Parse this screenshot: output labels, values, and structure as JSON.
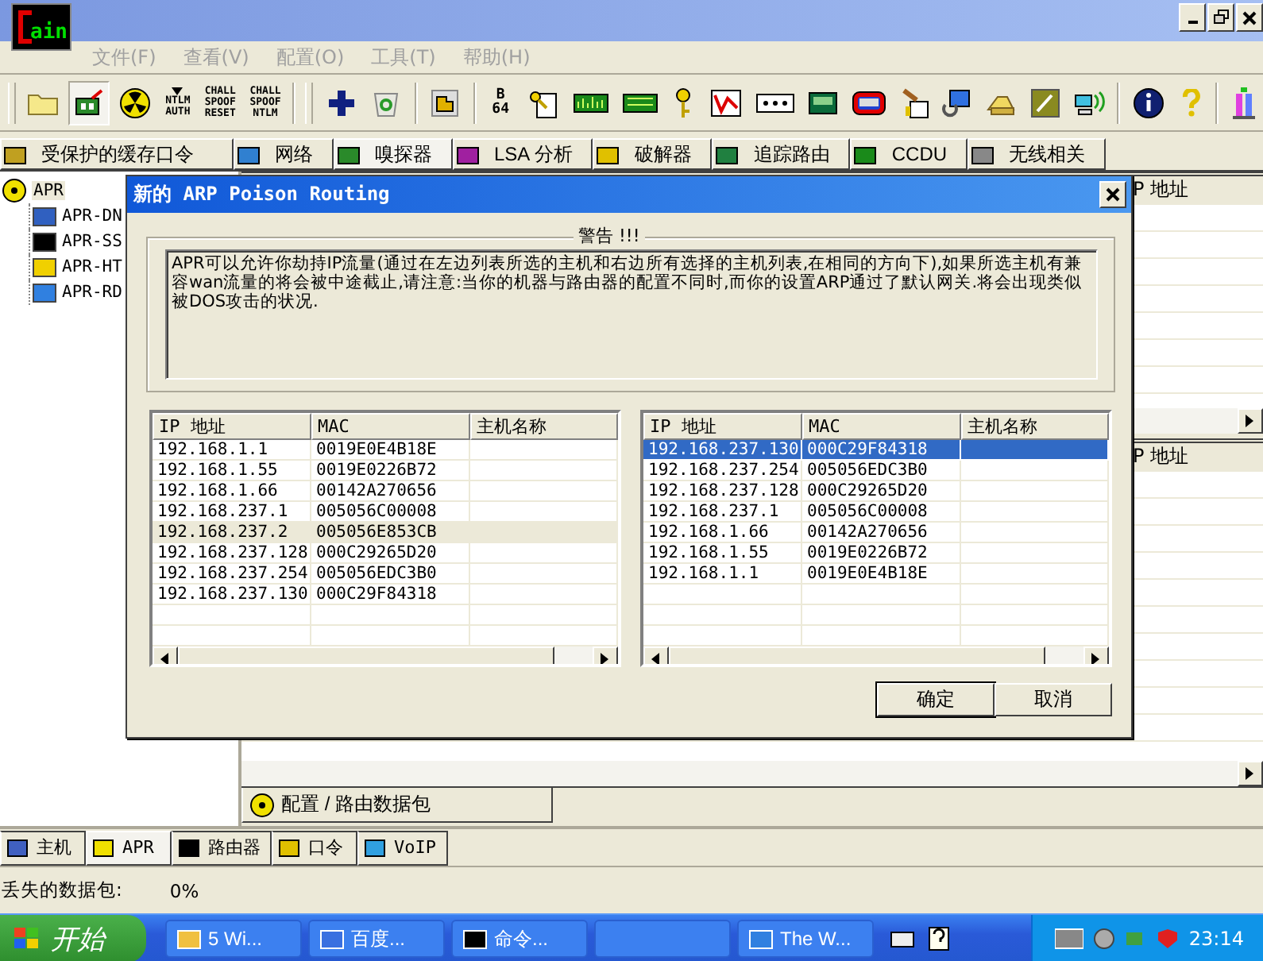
{
  "window": {
    "logo_text": "ain"
  },
  "menu": [
    {
      "label": "文件(F)",
      "disabled": true
    },
    {
      "label": "查看(V)",
      "disabled": true
    },
    {
      "label": "配置(O)",
      "disabled": true
    },
    {
      "label": "工具(T)",
      "disabled": true
    },
    {
      "label": "帮助(H)",
      "disabled": true
    }
  ],
  "toolbar_text": [
    "NTLM\nAUTH",
    "CHALL\nSPOOF\nRESET",
    "CHALL\nSPOOF\nNTLM",
    "B\n64"
  ],
  "tabs": [
    {
      "label": "受保护的缓存口令",
      "selected": false
    },
    {
      "label": "网络",
      "selected": false
    },
    {
      "label": "嗅探器",
      "selected": true
    },
    {
      "label": "LSA 分析",
      "selected": false
    },
    {
      "label": "破解器",
      "selected": false
    },
    {
      "label": "追踪路由",
      "selected": false
    },
    {
      "label": "CCDU",
      "selected": false
    },
    {
      "label": "无线相关",
      "selected": false
    }
  ],
  "tree": {
    "label": "APR",
    "children": [
      {
        "label": "APR-DN"
      },
      {
        "label": "APR-SS"
      },
      {
        "label": "APR-HT"
      },
      {
        "label": "APR-RD"
      }
    ]
  },
  "upper_list": {
    "column": "P 地址"
  },
  "lower_list": {
    "column": "P 地址",
    "tab": "配置 / 路由数据包"
  },
  "dialog": {
    "title": "新的 ARP Poison Routing",
    "group_title": "警告 !!!",
    "warning": "APR可以允许你劫持IP流量(通过在左边列表所选的主机和右边所有选择的主机列表,在相同的方向下),如果所选主机有兼容wan流量的将会被中途截止,请注意:当你的机器与路由器的配置不同时,而你的设置ARP通过了默认网关.将会出现类似被DOS攻击的状况.",
    "tables": [
      {
        "focused": false,
        "columns": [
          "IP 地址",
          "MAC",
          "主机名称"
        ],
        "rows": [
          {
            "ip": "192.168.1.1",
            "mac": "0019E0E4B18E",
            "selected": false
          },
          {
            "ip": "192.168.1.55",
            "mac": "0019E0226B72",
            "selected": false
          },
          {
            "ip": "192.168.1.66",
            "mac": "00142A270656",
            "selected": false
          },
          {
            "ip": "192.168.237.1",
            "mac": "005056C00008",
            "selected": false
          },
          {
            "ip": "192.168.237.2",
            "mac": "005056E853CB",
            "selected": true
          },
          {
            "ip": "192.168.237.128",
            "mac": "000C29265D20",
            "selected": false
          },
          {
            "ip": "192.168.237.254",
            "mac": "005056EDC3B0",
            "selected": false
          },
          {
            "ip": "192.168.237.130",
            "mac": "000C29F84318",
            "selected": false
          }
        ]
      },
      {
        "focused": true,
        "columns": [
          "IP 地址",
          "MAC",
          "主机名称"
        ],
        "rows": [
          {
            "ip": "192.168.237.130",
            "mac": "000C29F84318",
            "selected": true
          },
          {
            "ip": "192.168.237.254",
            "mac": "005056EDC3B0",
            "selected": false
          },
          {
            "ip": "192.168.237.128",
            "mac": "000C29265D20",
            "selected": false
          },
          {
            "ip": "192.168.237.1",
            "mac": "005056C00008",
            "selected": false
          },
          {
            "ip": "192.168.1.66",
            "mac": "00142A270656",
            "selected": false
          },
          {
            "ip": "192.168.1.55",
            "mac": "0019E0226B72",
            "selected": false
          },
          {
            "ip": "192.168.1.1",
            "mac": "0019E0E4B18E",
            "selected": false
          }
        ]
      }
    ],
    "buttons": [
      "确定",
      "取消"
    ]
  },
  "bottom_tabs": [
    {
      "label": "主机",
      "selected": false
    },
    {
      "label": "APR",
      "selected": true
    },
    {
      "label": "路由器",
      "selected": false
    },
    {
      "label": "口令",
      "selected": false
    },
    {
      "label": "VoIP",
      "selected": false
    }
  ],
  "status": {
    "label": "丢失的数据包:",
    "value": "0%"
  },
  "taskbar": {
    "start": "开始",
    "tasks": [
      {
        "label": "5 Wi..."
      },
      {
        "label": "百度..."
      },
      {
        "label": "命令..."
      },
      {
        "label": "The W..."
      }
    ],
    "clock": "23:14"
  }
}
